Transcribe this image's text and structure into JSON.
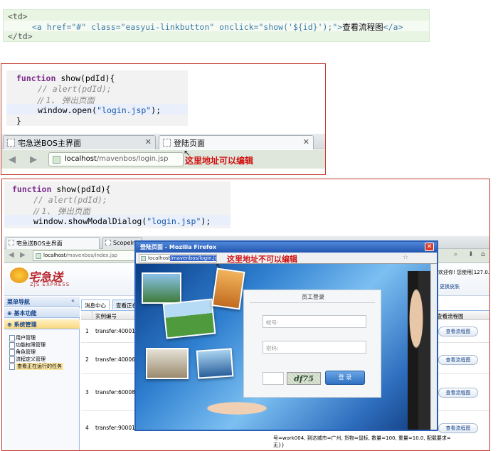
{
  "html_code": {
    "line1": "<td>",
    "line2_pre": "<a href=\"#\" class=\"easyui-linkbutton\" onclick=\"show('${id}');\">",
    "line2_text": "查看流程图",
    "line2_close": "</a>",
    "line3": "</td>"
  },
  "panel_a": {
    "code": {
      "l1_kw": "function",
      "l1_rest": " show(pdId){",
      "l2": "// alert(pdId);",
      "l3": "// 1、 弹出页面",
      "l4_a": "window.open(",
      "l4_s": "\"login.jsp\"",
      "l4_b": ");",
      "l5": "}"
    },
    "tabs": [
      {
        "label": "宅急送BOS主界面"
      },
      {
        "label": "登陆页面"
      }
    ],
    "url": {
      "domain": "localhost",
      "path": "/mavenbos/login.jsp"
    },
    "note": "这里地址可以编辑"
  },
  "panel_b": {
    "code": {
      "l1_kw": "function",
      "l1_rest": " show(pdId){",
      "l2": "// alert(pdId);",
      "l3": "// 1、 弹出页面",
      "l4_a": "window.showModalDialog(",
      "l4_s": "\"login.jsp\"",
      "l4_b": ");"
    },
    "browser": {
      "tabs": [
        "宅急送BOS主界面",
        "ScopeInsta"
      ],
      "url": {
        "domain": "localhost",
        "path": "/mavenbos/index.jsp"
      },
      "logo": "宅急送",
      "logo_sub": "ZJS EXPRESS",
      "welcome": "欢迎你! 您使用[127.0.0.1]",
      "skin": "更换皮肤",
      "sidebar": {
        "title": "菜单导航",
        "group1": "基本功能",
        "group2": "系统管理",
        "items": [
          "用户管理",
          "功能权限管理",
          "角色管理",
          "流程定义管理",
          "查看正在运行的任务"
        ]
      },
      "main_tabs": [
        "消息中心",
        "查看正在"
      ],
      "grid": {
        "col_id": "实例编号",
        "col_action": "查看流程图",
        "rows": [
          {
            "n": "1",
            "id": "transfer:40001"
          },
          {
            "n": "2",
            "id": "transfer:40006"
          },
          {
            "n": "3",
            "id": "transfer:60008"
          },
          {
            "n": "4",
            "id": "transfer:90001"
          }
        ],
        "button": "查看流程图",
        "footer_line1": "号=work004, 到达城市=广州, 货物=鼠标, 数量=100, 重量=10.0, 配载要求=",
        "footer_line2": "无}}"
      }
    },
    "modal": {
      "title": "登陆页面 - Mozilla Firefox",
      "close": "✕",
      "url_plain": "localhost",
      "url_selected": "/mavenbos/login.jsp",
      "login": {
        "title": "员工登录",
        "account_placeholder": "帐号:",
        "password_placeholder": "密码:",
        "captcha": "df75",
        "submit": "登 录"
      }
    },
    "note": "这里地址不可以编辑"
  }
}
